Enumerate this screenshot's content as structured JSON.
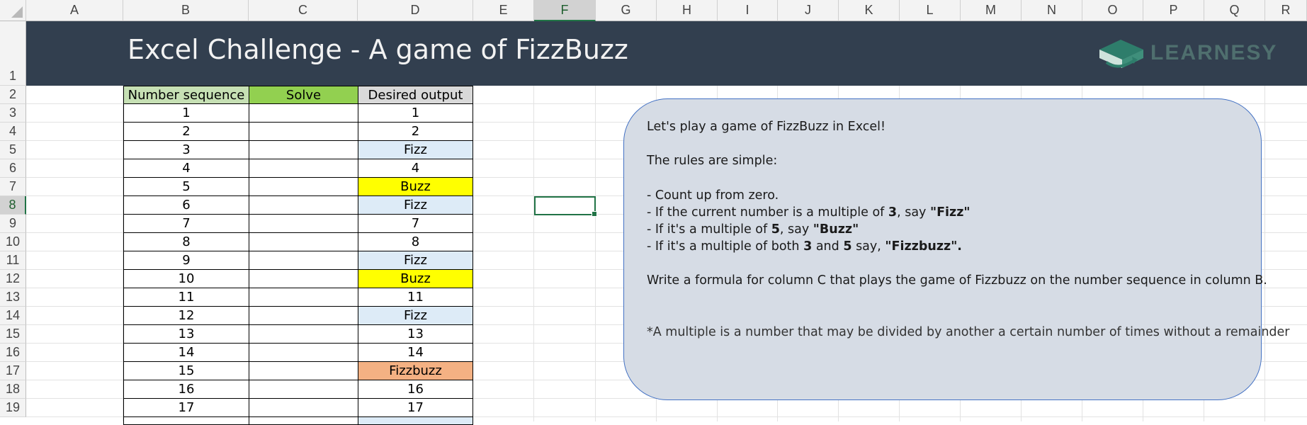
{
  "columns": [
    "A",
    "B",
    "C",
    "D",
    "E",
    "F",
    "G",
    "H",
    "I",
    "J",
    "K",
    "L",
    "M",
    "N",
    "O",
    "P",
    "Q",
    "R"
  ],
  "selected_column": "F",
  "rows": [
    "1",
    "2",
    "3",
    "4",
    "5",
    "6",
    "7",
    "8",
    "9",
    "10",
    "11",
    "12",
    "13",
    "14",
    "15",
    "16",
    "17",
    "18",
    "19"
  ],
  "selected_row": "8",
  "banner": {
    "title": "Excel Challenge - A game of FizzBuzz",
    "logo_text": "LEARNESY",
    "logo_icon": "book-icon",
    "color": "#323f4f"
  },
  "table": {
    "headers": [
      "Number sequence",
      "Solve",
      "Desired output"
    ],
    "header_colors": [
      "#c6e0b4",
      "#92d050",
      "#d9d9d9"
    ],
    "rows": [
      {
        "num": "1",
        "solve": "",
        "out": "1",
        "color": "#ffffff"
      },
      {
        "num": "2",
        "solve": "",
        "out": "2",
        "color": "#ffffff"
      },
      {
        "num": "3",
        "solve": "",
        "out": "Fizz",
        "color": "#ddebf7"
      },
      {
        "num": "4",
        "solve": "",
        "out": "4",
        "color": "#ffffff"
      },
      {
        "num": "5",
        "solve": "",
        "out": "Buzz",
        "color": "#ffff00"
      },
      {
        "num": "6",
        "solve": "",
        "out": "Fizz",
        "color": "#ddebf7"
      },
      {
        "num": "7",
        "solve": "",
        "out": "7",
        "color": "#ffffff"
      },
      {
        "num": "8",
        "solve": "",
        "out": "8",
        "color": "#ffffff"
      },
      {
        "num": "9",
        "solve": "",
        "out": "Fizz",
        "color": "#ddebf7"
      },
      {
        "num": "10",
        "solve": "",
        "out": "Buzz",
        "color": "#ffff00"
      },
      {
        "num": "11",
        "solve": "",
        "out": "11",
        "color": "#ffffff"
      },
      {
        "num": "12",
        "solve": "",
        "out": "Fizz",
        "color": "#ddebf7"
      },
      {
        "num": "13",
        "solve": "",
        "out": "13",
        "color": "#ffffff"
      },
      {
        "num": "14",
        "solve": "",
        "out": "14",
        "color": "#ffffff"
      },
      {
        "num": "15",
        "solve": "",
        "out": "Fizzbuzz",
        "color": "#f4b183"
      },
      {
        "num": "16",
        "solve": "",
        "out": "16",
        "color": "#ffffff"
      },
      {
        "num": "17",
        "solve": "",
        "out": "17",
        "color": "#ffffff"
      }
    ]
  },
  "note": {
    "intro": "Let's play a game of FizzBuzz in Excel!",
    "rules_intro": "The rules are simple:",
    "rule1": "- Count up from zero.",
    "rule2_a": "- If the current number is a multiple of ",
    "rule2_b": "3",
    "rule2_c": ", say ",
    "rule2_d": "\"Fizz\"",
    "rule3_a": "- If it's a multiple of ",
    "rule3_b": "5",
    "rule3_c": ", say ",
    "rule3_d": "\"Buzz\"",
    "rule4_a": "- If it's a multiple of both ",
    "rule4_b": "3",
    "rule4_c": " and ",
    "rule4_d": "5",
    "rule4_e": " say, ",
    "rule4_f": "\"Fizzbuzz\".",
    "task": "Write a formula for column C that plays the game of Fizzbuzz on the number sequence in column B.",
    "footnote": "*A multiple is a number that may be divided by another a certain number of times without a remainder",
    "fill": "#d6dce5",
    "border": "#4472c4"
  }
}
